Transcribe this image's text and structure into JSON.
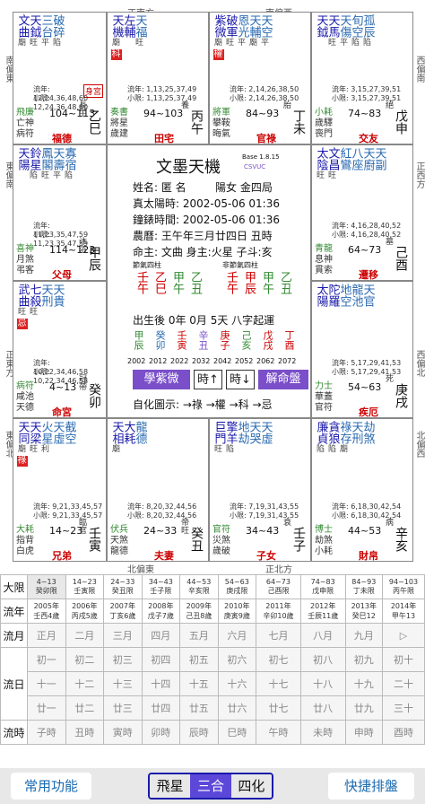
{
  "directions": {
    "top_left": "正南方",
    "top_right": "南偏西",
    "left_top": "南偏東",
    "right_top": "西偏南",
    "left_mid": "東偏南",
    "right_mid": "正西方",
    "left_low": "正東方",
    "right_low": "西偏北",
    "left_bot": "東偏北",
    "right_bot": "北偏西",
    "bot_left": "北偏東",
    "bot_right": "正北方"
  },
  "palaces": [
    {
      "stars": [
        "文曲",
        "天鉞",
        "三台",
        "破碎"
      ],
      "bright": [
        "廟",
        "旺",
        "平",
        "陷"
      ],
      "hua": "",
      "life": "身宮",
      "liunian": "流年: 12,24,36,48,60",
      "xiaoxian": "小限: 12,24,36,48,60",
      "minor": [
        "飛廉",
        "亡神",
        "病符"
      ],
      "range": "104~113",
      "palace": "福德",
      "stage": "長生",
      "gz": "乙巳"
    },
    {
      "stars": [
        "天機",
        "左輔",
        "天福"
      ],
      "bright": [
        "廟",
        "",
        "旺"
      ],
      "hua": "科",
      "life": "",
      "liunian": "流年: 1,13,25,37,49",
      "xiaoxian": "小限: 1,13,25,37,49",
      "minor": [
        "奏書",
        "將星",
        "歲建"
      ],
      "range": "94~103",
      "palace": "田宅",
      "stage": "養",
      "gz": "丙午"
    },
    {
      "stars": [
        "紫微",
        "破軍",
        "恩光",
        "天輔",
        "天空"
      ],
      "bright": [
        "廟",
        "旺",
        "平",
        "廟",
        "平"
      ],
      "hua": "權",
      "life": "",
      "liunian": "流年: 2,14,26,38,50",
      "xiaoxian": "小限: 2,14,26,38,50",
      "minor": [
        "將軍",
        "攀鞍",
        "晦氣"
      ],
      "range": "84~93",
      "palace": "官祿",
      "stage": "胎",
      "gz": "丁未"
    },
    {
      "stars": [
        "天鉞",
        "天馬",
        "天傷",
        "旬空",
        "孤辰"
      ],
      "bright": [
        "",
        "旺",
        "平",
        "陷",
        "陷"
      ],
      "hua": "",
      "life": "",
      "liunian": "流年: 3,15,27,39,51",
      "xiaoxian": "小限: 3,15,27,39,51",
      "minor": [
        "小耗",
        "歲驛",
        "喪門"
      ],
      "range": "74~83",
      "palace": "交友",
      "stage": "絕",
      "gz": "戊申"
    },
    {
      "stars": [
        "天陽",
        "鈴星",
        "鳳閣",
        "天壽",
        "寡宿"
      ],
      "bright": [
        "",
        "陷",
        "旺",
        "平",
        "陷"
      ],
      "hua": "",
      "life": "",
      "liunian": "流年: 11,23,35,47,59",
      "xiaoxian": "小限: 11,23,35,47,59",
      "minor": [
        "喜神",
        "月煞",
        "弔客"
      ],
      "range": "114~123",
      "palace": "父母",
      "stage": "沐浴",
      "gz": "甲辰"
    },
    {
      "stars": [
        "太陰",
        "文昌",
        "紅鸞",
        "八座",
        "天廚",
        "天副"
      ],
      "bright": [
        "旺",
        "旺",
        "",
        "",
        "",
        ""
      ],
      "hua": "",
      "life": "",
      "liunian": "流年: 4,16,28,40,52",
      "xiaoxian": "小限: 4,16,28,40,52",
      "minor": [
        "青龍",
        "息神",
        "貫索"
      ],
      "range": "64~73",
      "palace": "遷移",
      "stage": "墓",
      "gz": "己酉"
    },
    {
      "stars": [
        "武曲",
        "七殺",
        "天刑",
        "天貴"
      ],
      "bright": [
        "旺",
        "旺",
        "",
        ""
      ],
      "hua": "忌",
      "life": "",
      "liunian": "流年: 10,22,34,46,58",
      "xiaoxian": "小限: 10,22,34,46,58",
      "minor": [
        "病符",
        "咸池",
        "天德"
      ],
      "range": "4~13",
      "palace": "命宮",
      "stage": "冠帶",
      "gz": "癸卯"
    },
    {
      "stars": [
        "太陽",
        "陀羅",
        "地空",
        "龍池",
        "天官"
      ],
      "bright": [
        "",
        "",
        "",
        "",
        ""
      ],
      "hua": "",
      "life": "",
      "liunian": "流年: 5,17,29,41,53",
      "xiaoxian": "小限: 5,17,29,41,53",
      "minor": [
        "力士",
        "華蓋",
        "官符"
      ],
      "range": "54~63",
      "palace": "疾厄",
      "stage": "死",
      "gz": "庚戌"
    },
    {
      "stars": [
        "天同",
        "天梁",
        "火星",
        "天虛",
        "截空"
      ],
      "bright": [
        "廟",
        "旺",
        "利",
        "",
        ""
      ],
      "hua": "祿",
      "life": "",
      "liunian": "流年: 9,21,33,45,57",
      "xiaoxian": "小限: 9,21,33,45,57",
      "minor": [
        "大耗",
        "指背",
        "白虎"
      ],
      "range": "14~23",
      "palace": "兄弟",
      "stage": "臨官",
      "gz": "壬寅"
    },
    {
      "stars": [
        "天相",
        "大耗",
        "龍德"
      ],
      "bright": [
        "廟",
        "",
        ""
      ],
      "hua": "",
      "life": "",
      "liunian": "流年: 8,20,32,44,56",
      "xiaoxian": "小限: 8,20,32,44,56",
      "minor": [
        "伏兵",
        "天煞",
        "龍德"
      ],
      "range": "24~33",
      "palace": "夫妻",
      "stage": "帝旺",
      "gz": "癸丑"
    },
    {
      "stars": [
        "巨門",
        "擎羊",
        "地劫",
        "天哭",
        "天虛"
      ],
      "bright": [
        "旺",
        "陷",
        "",
        "",
        ""
      ],
      "hua": "",
      "life": "",
      "liunian": "流年: 7,19,31,43,55",
      "xiaoxian": "小限: 7,19,31,43,55",
      "minor": [
        "官符",
        "災煞",
        "歲破"
      ],
      "range": "34~43",
      "palace": "子女",
      "stage": "衰",
      "gz": "壬子"
    },
    {
      "stars": [
        "廉貞",
        "貪狼",
        "祿存",
        "天刑",
        "劫煞"
      ],
      "bright": [
        "陷",
        "陷",
        "廟",
        "",
        ""
      ],
      "hua": "",
      "life": "",
      "liunian": "流年: 6,18,30,42,54",
      "xiaoxian": "小限: 6,18,30,42,54",
      "minor": [
        "博士",
        "劫煞",
        "小耗"
      ],
      "range": "44~53",
      "palace": "財帛",
      "stage": "病",
      "gz": "辛亥"
    }
  ],
  "center": {
    "title": "文墨天機",
    "base": "Base 1.8.15",
    "csvuc": "CSVUC",
    "name": "姓名: 匿 名",
    "gender": "陽女 金四局",
    "truesolar": "真太陽時: 2002-05-06 01:36",
    "clock": "鐘錶時間: 2002-05-06 01:36",
    "lunar": "農曆: 王午年三月廿四日 丑時",
    "ming": "命主: 文曲 身主:火星 子斗:亥",
    "pillars_label": "節氣四柱",
    "pillars": [
      "壬午",
      "乙巳",
      "甲午",
      "乙丑"
    ],
    "pillars2_label": "非節氣四柱",
    "pillars2": [
      "壬午",
      "甲辰",
      "甲午",
      "乙丑"
    ],
    "birth": "出生後 0年 0月 5天 八字起運",
    "dayun": [
      "甲辰",
      "癸卯",
      "壬寅",
      "辛丑",
      "庚子",
      "己亥",
      "戊戌",
      "丁酉"
    ],
    "dayun_age": [
      "2002",
      "2012",
      "2022",
      "2032",
      "2042",
      "2052",
      "2062",
      "2072"
    ],
    "btn_learn": "學紫微",
    "btn_time1": "時↑",
    "btn_time2": "時↓",
    "btn_explain": "解命盤",
    "auto": "自化圖示: →祿 →權 →科 →忌"
  },
  "table": {
    "row_daxian": "大限",
    "daxian": [
      "4~13\n癸卯限",
      "14~23\n壬寅限",
      "24~33\n癸丑限",
      "34~43\n壬子限",
      "44~53\n辛亥限",
      "54~63\n庚戌限",
      "64~73\n己酉限",
      "74~83\n戊申限",
      "84~93\n丁未限",
      "94~103\n丙午限"
    ],
    "row_liunian": "流年",
    "liunian": [
      "2005年\n壬西4歲",
      "2006年\n丙戌5歲",
      "2007年\n丁亥6歲",
      "2008年\n戊子7歲",
      "2009年\n己丑8歲",
      "2010年\n庚寅9歲",
      "2011年\n辛卯10歲",
      "2012年\n壬辰11歲",
      "2013年\n癸巳12",
      "2014年\n甲午13"
    ],
    "row_liuyue": "流月",
    "liuyue": [
      "正月",
      "二月",
      "三月",
      "四月",
      "五月",
      "六月",
      "七月",
      "八月",
      "九月",
      "▷"
    ],
    "row_liuri": "流日",
    "liuri1": [
      "初一",
      "初二",
      "初三",
      "初四",
      "初五",
      "初六",
      "初七",
      "初八",
      "初九",
      "初十"
    ],
    "liuri2": [
      "十一",
      "十二",
      "十三",
      "十四",
      "十五",
      "十六",
      "十七",
      "十八",
      "十九",
      "二十"
    ],
    "liuri3": [
      "廿一",
      "廿二",
      "廿三",
      "廿四",
      "廿五",
      "廿六",
      "廿七",
      "廿八",
      "廿九",
      "三十"
    ],
    "row_liushi": "流時",
    "liushi": [
      "子時",
      "丑時",
      "寅時",
      "卯時",
      "辰時",
      "巳時",
      "午時",
      "未時",
      "申時",
      "酉時"
    ]
  },
  "footer": {
    "left": "常用功能",
    "tab1": "飛星",
    "tab2": "三合",
    "tab3": "四化",
    "right": "快捷排盤"
  },
  "colors": {
    "accent": "#1a1aaa",
    "red": "#d22",
    "purple": "#7a4fc9",
    "green": "#338a33"
  }
}
